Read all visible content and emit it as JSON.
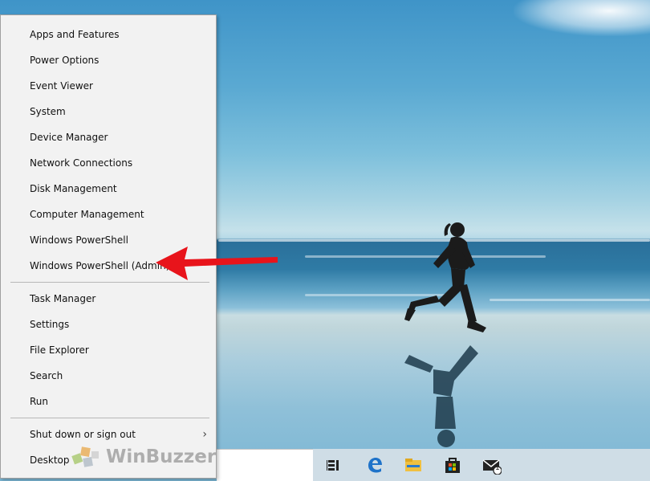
{
  "menu": {
    "items_group1": [
      {
        "label": "Apps and Features",
        "name": "menu-item-apps-and-features"
      },
      {
        "label": "Power Options",
        "name": "menu-item-power-options"
      },
      {
        "label": "Event Viewer",
        "name": "menu-item-event-viewer"
      },
      {
        "label": "System",
        "name": "menu-item-system"
      },
      {
        "label": "Device Manager",
        "name": "menu-item-device-manager"
      },
      {
        "label": "Network Connections",
        "name": "menu-item-network-connections"
      },
      {
        "label": "Disk Management",
        "name": "menu-item-disk-management"
      },
      {
        "label": "Computer Management",
        "name": "menu-item-computer-management"
      },
      {
        "label": "Windows PowerShell",
        "name": "menu-item-windows-powershell"
      },
      {
        "label": "Windows PowerShell (Admin)",
        "name": "menu-item-windows-powershell-admin"
      }
    ],
    "items_group2": [
      {
        "label": "Task Manager",
        "name": "menu-item-task-manager"
      },
      {
        "label": "Settings",
        "name": "menu-item-settings"
      },
      {
        "label": "File Explorer",
        "name": "menu-item-file-explorer"
      },
      {
        "label": "Search",
        "name": "menu-item-search"
      },
      {
        "label": "Run",
        "name": "menu-item-run"
      }
    ],
    "items_group3": [
      {
        "label": "Shut down or sign out",
        "name": "menu-item-shut-down-or-sign-out",
        "submenu": true
      },
      {
        "label": "Desktop",
        "name": "menu-item-desktop"
      }
    ]
  },
  "taskbar": {
    "icons": [
      "task-view-icon",
      "edge-icon",
      "file-explorer-icon",
      "store-icon",
      "mail-icon"
    ],
    "mail_badge": "1"
  },
  "annotation": {
    "arrow_color": "#e8141b",
    "target": "Windows PowerShell (Admin)"
  },
  "watermark": {
    "text": "WinBuzzer"
  },
  "colors": {
    "menu_bg": "#f2f2f2",
    "taskbar_bg": "#cfdde6",
    "arrow": "#e8141b"
  }
}
